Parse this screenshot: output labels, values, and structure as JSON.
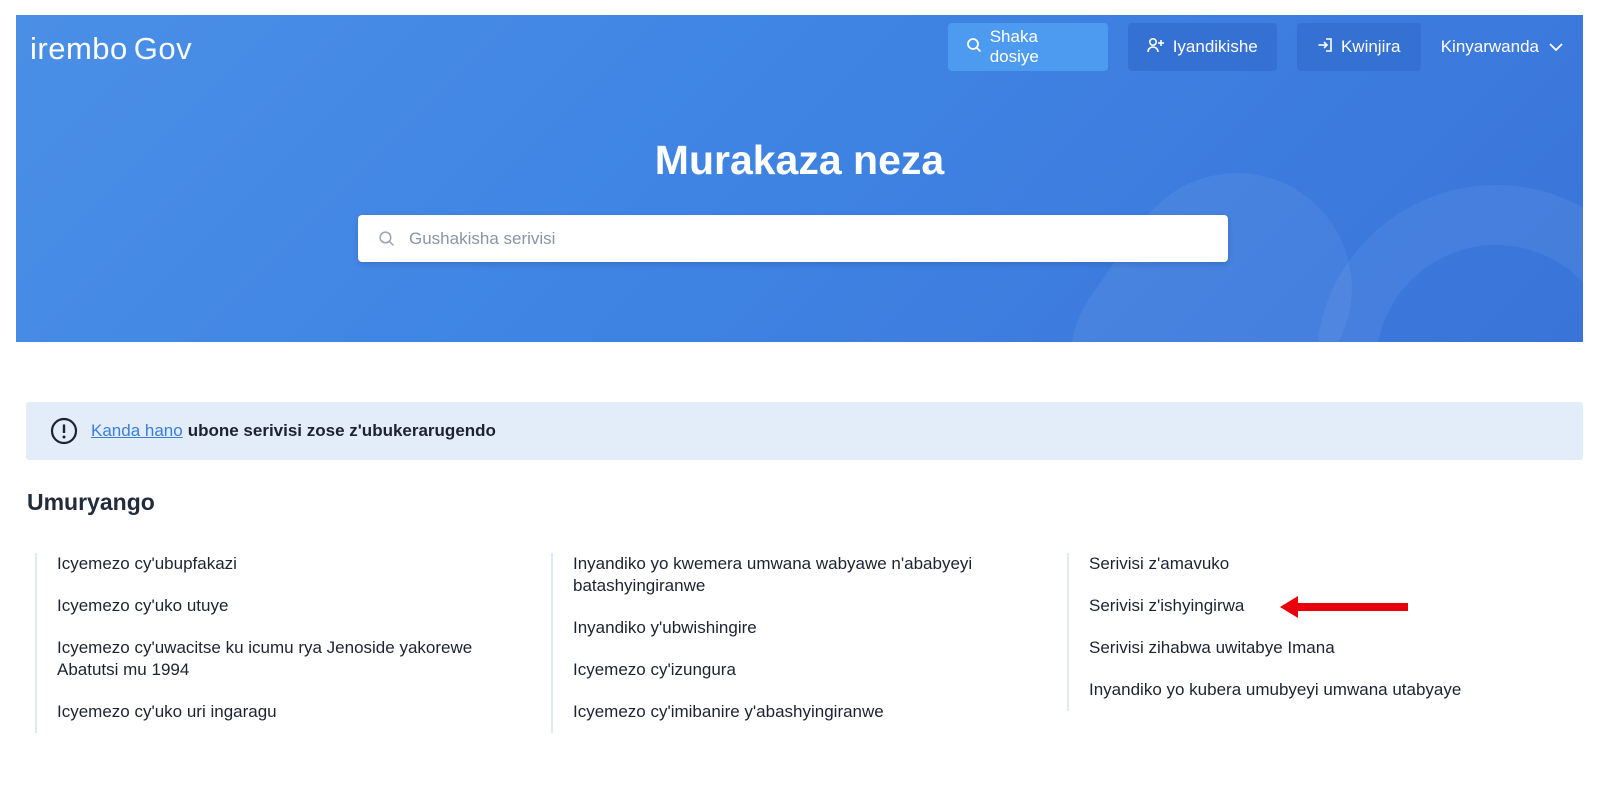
{
  "header": {
    "logo_brand": "irembo",
    "logo_gov": "Gov",
    "nav": {
      "search_label": "Shaka dosiye",
      "register_label": "Iyandikishe",
      "login_label": "Kwinjira",
      "language": "Kinyarwanda"
    }
  },
  "hero": {
    "title": "Murakaza neza",
    "search_placeholder": "Gushakisha serivisi"
  },
  "notice": {
    "link_text": "Kanda hano",
    "text": "ubone serivisi zose z'ubukerarugendo"
  },
  "section": {
    "title": "Umuryango",
    "columns": [
      [
        "Icyemezo cy'ubupfakazi",
        "Icyemezo cy'uko utuye",
        "Icyemezo cy'uwacitse ku icumu rya Jenoside yakorewe Abatutsi mu 1994",
        "Icyemezo cy'uko uri ingaragu"
      ],
      [
        "Inyandiko yo kwemera umwana wabyawe n'ababyeyi batashyingiranwe",
        "Inyandiko y'ubwishingire",
        "Icyemezo cy'izungura",
        "Icyemezo cy'imibanire y'abashyingiranwe"
      ],
      [
        "Serivisi z'amavuko",
        "Serivisi z'ishyingirwa",
        "Serivisi zihabwa uwitabye Imana",
        "Inyandiko yo kubera umubyeyi umwana utabyaye"
      ]
    ]
  },
  "colors": {
    "hero_blue": "#3f84e3",
    "notice_bg": "#e3edf9",
    "link": "#3b7ddd",
    "arrow": "#e8000b"
  }
}
